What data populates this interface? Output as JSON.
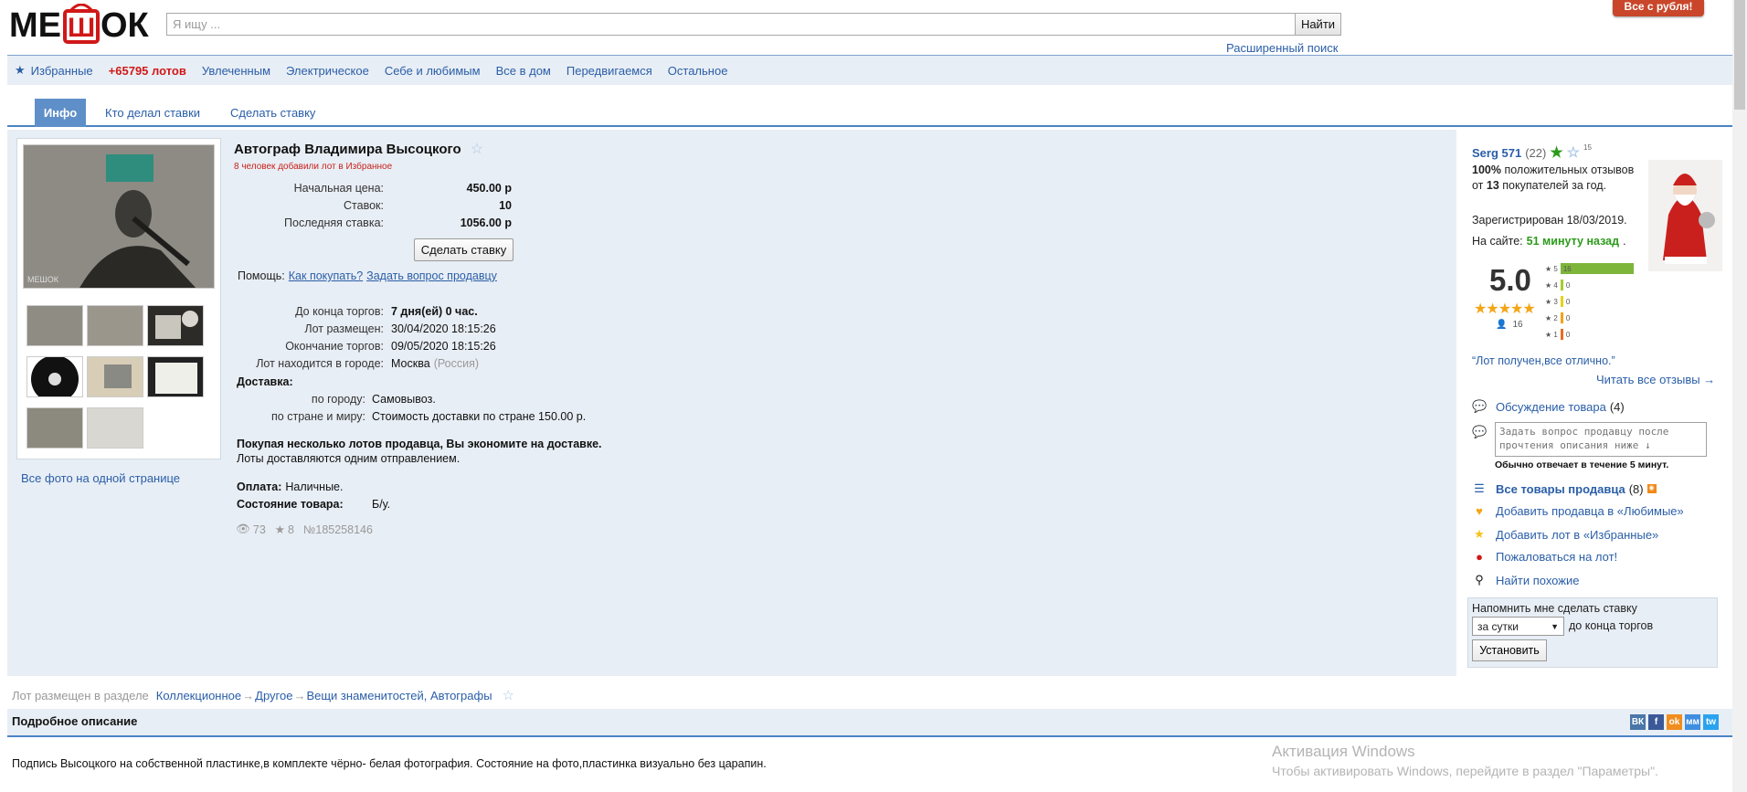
{
  "header": {
    "logo_text": "МЕШОК",
    "search_placeholder": "Я ищу ...",
    "search_button": "Найти",
    "advanced_search": "Расширенный поиск",
    "promo_badge": "Все с рубля!"
  },
  "nav": {
    "items": [
      {
        "label": "Избранные",
        "icon": "star-icon"
      },
      {
        "label": "+65795 лотов"
      },
      {
        "label": "Увлеченным"
      },
      {
        "label": "Электрическое"
      },
      {
        "label": "Себе и любимым"
      },
      {
        "label": "Все в дом"
      },
      {
        "label": "Передвигаемся"
      },
      {
        "label": "Остальное"
      }
    ]
  },
  "tabs": [
    {
      "label": "Инфо",
      "active": true
    },
    {
      "label": "Кто делал ставки"
    },
    {
      "label": "Сделать ставку"
    }
  ],
  "gallery": {
    "all_photos_link": "Все фото на одной странице"
  },
  "lot": {
    "title": "Автограф Владимира Высоцкого",
    "favorites_note": "8 человек добавили лот в Избранное",
    "start_price_label": "Начальная цена:",
    "start_price": "450.00 р",
    "bids_label": "Ставок:",
    "bids": "10",
    "last_bid_label": "Последняя ставка:",
    "last_bid": "1056.00 р",
    "make_bid_button": "Сделать ставку",
    "help_label": "Помощь:",
    "help_how": "Как покупать?",
    "help_ask": "Задать вопрос продавцу",
    "ends_in_label": "До конца торгов:",
    "ends_in": "7 дня(ей) 0 час.",
    "placed_label": "Лот размещен:",
    "placed": "30/04/2020 18:15:26",
    "end_label": "Окончание торгов:",
    "end": "09/05/2020 18:15:26",
    "city_label": "Лот находится в городе:",
    "city": "Москва",
    "country": "(Россия)",
    "delivery_label": "Доставка:",
    "delivery_city_label": "по городу:",
    "delivery_city": "Самовывоз.",
    "delivery_world_label": "по стране и миру:",
    "delivery_world": "Стоимость доставки по стране 150.00 р.",
    "multi_lot_note": "Покупая несколько лотов продавца, Вы экономите на доставке.",
    "multi_lot_sub": "Лоты доставляются одним отправлением.",
    "payment_label": "Оплата:",
    "payment": "Наличные.",
    "condition_label": "Состояние товара:",
    "condition": "Б/у.",
    "views": "73",
    "stars": "8",
    "lot_number": "№185258146"
  },
  "seller": {
    "name": "Serg 571",
    "reviews_count": "(22)",
    "star_level": "15",
    "positive_pct": "100%",
    "positive_text_1": "положительных",
    "positive_text_2": "отзывов от",
    "buyers_count": "13",
    "positive_text_3": "покупателей за год.",
    "registered": "Зарегистрирован 18/03/2019.",
    "online_label": "На сайте:",
    "online": "51 минуту назад",
    "rating": "5.0",
    "rating_votes": "16",
    "rating_bars": [
      {
        "star": "5",
        "count": "16",
        "fraction": 1.0,
        "color": "#7db53a"
      },
      {
        "star": "4",
        "count": "0",
        "fraction": 0,
        "color": "#a6cc2a"
      },
      {
        "star": "3",
        "count": "0",
        "fraction": 0,
        "color": "#e4d21d"
      },
      {
        "star": "2",
        "count": "0",
        "fraction": 0,
        "color": "#f3a21b"
      },
      {
        "star": "1",
        "count": "0",
        "fraction": 0,
        "color": "#ec6a1e"
      }
    ],
    "quote": "“Лот получен,все отлично.”",
    "read_all": "Читать все отзывы →",
    "discussion": "Обсуждение товара",
    "discussion_count": "(4)",
    "question_placeholder": "Задать вопрос продавцу после прочтения описания ниже ↓",
    "reply_time": "Обычно отвечает в течение 5 минут.",
    "all_goods": "Все товары продавца",
    "all_goods_count": "(8)",
    "add_seller_fav": "Добавить продавца в «Любимые»",
    "add_lot_fav": "Добавить лот в «Избранные»",
    "complain": "Пожаловаться на лот!",
    "find_similar": "Найти похожие",
    "remind_label": "Напомнить мне сделать ставку",
    "remind_option": "за сутки",
    "remind_suffix": "до конца торгов",
    "remind_button": "Установить"
  },
  "breadcrumb": {
    "prefix": "Лот размещен в разделе",
    "items": [
      "Коллекционное",
      "Другое",
      "Вещи знаменитостей, Автографы"
    ]
  },
  "description": {
    "title": "Подробное описание",
    "text": "Подпись Высоцкого на собственной пластинке,в комплекте чёрно- белая фотография. Состояние на фото,пластинка визуально без царапин."
  },
  "share": [
    "ВК",
    "f",
    "ok",
    "мм",
    "tw"
  ],
  "windows": {
    "title": "Активация Windows",
    "subtitle": "Чтобы активировать Windows, перейдите в раздел \"Параметры\"."
  },
  "colors": {
    "accent": "#2a5ea8",
    "panel": "#e8eef5",
    "lots": "#d01818",
    "online": "#2c9a1a"
  }
}
